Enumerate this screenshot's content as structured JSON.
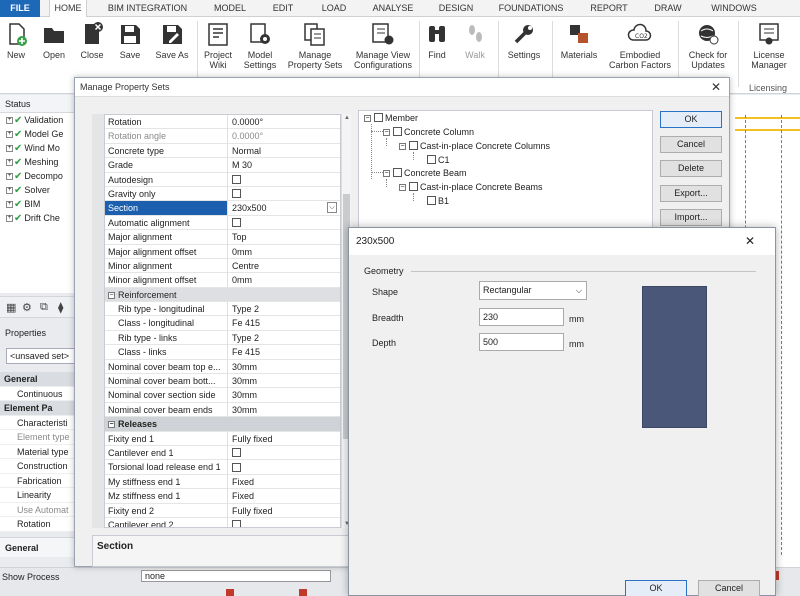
{
  "ribbon": {
    "tabs": [
      "FILE",
      "HOME",
      "BIM INTEGRATION",
      "MODEL",
      "EDIT",
      "LOAD",
      "ANALYSE",
      "DESIGN",
      "FOUNDATIONS",
      "REPORT",
      "DRAW",
      "WINDOWS"
    ],
    "buttons": {
      "new": "New",
      "open": "Open",
      "close": "Close",
      "save": "Save",
      "save_as": "Save As",
      "project_wiki_1": "Project",
      "project_wiki_2": "Wiki",
      "model_settings_1": "Model",
      "model_settings_2": "Settings",
      "manage_props_1": "Manage",
      "manage_props_2": "Property Sets",
      "manage_view_1": "Manage View",
      "manage_view_2": "Configurations",
      "find": "Find",
      "walk": "Walk",
      "settings": "Settings",
      "materials": "Materials",
      "embodied_1": "Embodied",
      "embodied_2": "Carbon Factors",
      "check_1": "Check for",
      "check_2": "Updates",
      "license_1": "License",
      "license_2": "Manager"
    },
    "group_licensing": "Licensing"
  },
  "status_panel": {
    "title": "Status",
    "items": [
      "Validation",
      "Model Ge",
      "Wind Mo",
      "Meshing",
      "Decompo",
      "Solver",
      "BIM",
      "Drift Che"
    ]
  },
  "properties_panel": {
    "title": "Properties",
    "selector": "<unsaved set>",
    "rows": [
      {
        "label": "General",
        "cat": true
      },
      {
        "label": "Continuous"
      },
      {
        "label": "Element Pa",
        "cat": true
      },
      {
        "label": "Characteristi"
      },
      {
        "label": "Element type",
        "grey": true
      },
      {
        "label": "Material type"
      },
      {
        "label": "Construction"
      },
      {
        "label": "Fabrication"
      },
      {
        "label": "Linearity"
      },
      {
        "label": "Use Automat",
        "grey": true
      },
      {
        "label": "Rotation"
      }
    ],
    "general_bar": "General"
  },
  "bottom": {
    "show_process": "Show Process",
    "none_value": "none"
  },
  "dialog": {
    "title": "Manage Property Sets",
    "close": "✕",
    "grid_rows": [
      {
        "name": "Rotation",
        "value": "0.0000°"
      },
      {
        "name": "Rotation angle",
        "value": "0.0000°",
        "grey": true
      },
      {
        "name": "Concrete type",
        "value": "Normal"
      },
      {
        "name": "Grade",
        "value": "M 30"
      },
      {
        "name": "Autodesign",
        "value": "",
        "cb": true
      },
      {
        "name": "Gravity only",
        "value": "",
        "cb": true
      },
      {
        "name": "Section",
        "value": "230x500",
        "sel": true
      },
      {
        "name": "Automatic alignment",
        "value": "",
        "cb": true
      },
      {
        "name": "Major alignment",
        "value": "Top"
      },
      {
        "name": "Major alignment offset",
        "value": "0mm"
      },
      {
        "name": "Minor alignment",
        "value": "Centre"
      },
      {
        "name": "Minor alignment offset",
        "value": "0mm"
      },
      {
        "name": "Reinforcement",
        "value": "",
        "sub": true
      },
      {
        "name": "Rib type - longitudinal",
        "value": "Type 2",
        "indent": true
      },
      {
        "name": "Class - longitudinal",
        "value": "Fe 415",
        "indent": true
      },
      {
        "name": "Rib type - links",
        "value": "Type 2",
        "indent": true
      },
      {
        "name": "Class - links",
        "value": "Fe 415",
        "indent": true
      },
      {
        "name": "Nominal cover beam top e...",
        "value": "30mm"
      },
      {
        "name": "Nominal cover beam bott...",
        "value": "30mm"
      },
      {
        "name": "Nominal cover section side",
        "value": "30mm"
      },
      {
        "name": "Nominal cover beam ends",
        "value": "30mm"
      },
      {
        "name": "Releases",
        "value": "",
        "head": true
      },
      {
        "name": "Fixity end 1",
        "value": "Fully fixed"
      },
      {
        "name": "Cantilever end 1",
        "value": "",
        "cb": true
      },
      {
        "name": "Torsional load release end 1",
        "value": "",
        "cb": true
      },
      {
        "name": "My stiffness end 1",
        "value": "Fixed"
      },
      {
        "name": "Mz stiffness end 1",
        "value": "Fixed"
      },
      {
        "name": "Fixity end 2",
        "value": "Fully fixed"
      },
      {
        "name": "Cantilever end 2",
        "value": "",
        "cb": true
      }
    ],
    "description_title": "Section",
    "tree": {
      "member": "Member",
      "concrete_column": "Concrete Column",
      "cip_columns": "Cast-in-place Concrete Columns",
      "c1": "C1",
      "concrete_beam": "Concrete Beam",
      "cip_beams": "Cast-in-place Concrete Beams",
      "b1": "B1"
    },
    "buttons": {
      "ok": "OK",
      "cancel": "Cancel",
      "delete": "Delete",
      "export": "Export...",
      "import": "Import..."
    }
  },
  "section_dialog": {
    "title": "230x500",
    "close": "✕",
    "geometry_label": "Geometry",
    "shape_label": "Shape",
    "shape_value": "Rectangular",
    "breadth_label": "Breadth",
    "breadth_value": "230",
    "depth_label": "Depth",
    "depth_value": "500",
    "unit": "mm",
    "ok": "OK",
    "cancel": "Cancel",
    "preview_color": "#4a5779"
  },
  "colors": {
    "accent": "#1e68b8",
    "selection": "#1b5fae",
    "check": "#2f9e44"
  }
}
